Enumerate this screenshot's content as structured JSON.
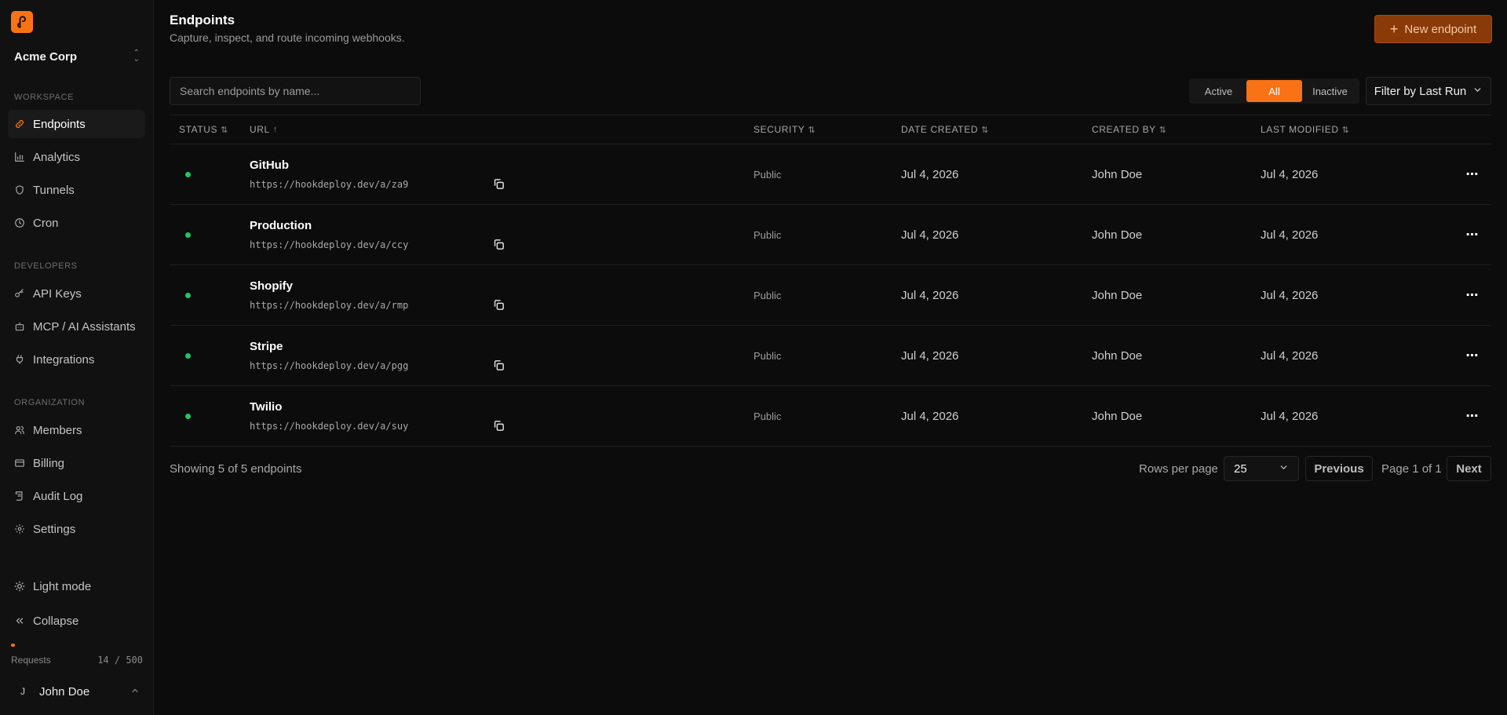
{
  "brand": {
    "accent": "#f97316",
    "status_active_color": "#22c55e",
    "logo_icon": "hook-logo-icon"
  },
  "org": {
    "name": "Acme Corp"
  },
  "sidebar": {
    "sections": [
      {
        "label": "WORKSPACE",
        "items": [
          {
            "label": "Endpoints",
            "icon": "link-icon",
            "active": true
          },
          {
            "label": "Analytics",
            "icon": "bar-chart-icon"
          },
          {
            "label": "Tunnels",
            "icon": "shield-icon"
          },
          {
            "label": "Cron",
            "icon": "clock-icon"
          }
        ]
      },
      {
        "label": "DEVELOPERS",
        "items": [
          {
            "label": "API Keys",
            "icon": "key-icon"
          },
          {
            "label": "MCP / AI Assistants",
            "icon": "bot-icon"
          },
          {
            "label": "Integrations",
            "icon": "plug-icon"
          }
        ]
      },
      {
        "label": "ORGANIZATION",
        "items": [
          {
            "label": "Members",
            "icon": "users-icon"
          },
          {
            "label": "Billing",
            "icon": "credit-card-icon"
          },
          {
            "label": "Audit Log",
            "icon": "scroll-icon"
          },
          {
            "label": "Settings",
            "icon": "gear-icon"
          }
        ]
      }
    ],
    "light_mode": "Light mode",
    "collapse": "Collapse",
    "usage": {
      "label": "Requests",
      "value": "14 / 500",
      "used": 14,
      "limit": 500
    },
    "user": {
      "initial": "J",
      "name": "John Doe"
    }
  },
  "header": {
    "title": "Endpoints",
    "subtitle": "Capture, inspect, and route incoming webhooks.",
    "new_button": "New endpoint"
  },
  "toolbar": {
    "search_placeholder": "Search endpoints by name...",
    "segments": [
      "Active",
      "All",
      "Inactive"
    ],
    "selected_segment": "All",
    "filter_label": "Filter by Last Run"
  },
  "table": {
    "columns": [
      "STATUS",
      "URL",
      "SECURITY",
      "DATE CREATED",
      "CREATED BY",
      "LAST MODIFIED"
    ],
    "rows": [
      {
        "name": "GitHub",
        "url": "https://hookdeploy.dev/a/za9",
        "security": "Public",
        "date_created": "Jul 4, 2026",
        "created_by": "John Doe",
        "last_modified": "Jul 4, 2026"
      },
      {
        "name": "Production",
        "url": "https://hookdeploy.dev/a/ccy",
        "security": "Public",
        "date_created": "Jul 4, 2026",
        "created_by": "John Doe",
        "last_modified": "Jul 4, 2026"
      },
      {
        "name": "Shopify",
        "url": "https://hookdeploy.dev/a/rmp",
        "security": "Public",
        "date_created": "Jul 4, 2026",
        "created_by": "John Doe",
        "last_modified": "Jul 4, 2026"
      },
      {
        "name": "Stripe",
        "url": "https://hookdeploy.dev/a/pgg",
        "security": "Public",
        "date_created": "Jul 4, 2026",
        "created_by": "John Doe",
        "last_modified": "Jul 4, 2026"
      },
      {
        "name": "Twilio",
        "url": "https://hookdeploy.dev/a/suy",
        "security": "Public",
        "date_created": "Jul 4, 2026",
        "created_by": "John Doe",
        "last_modified": "Jul 4, 2026"
      }
    ]
  },
  "footer": {
    "showing": "Showing 5 of 5 endpoints",
    "rows_per_page_label": "Rows per page",
    "rows_per_page": "25",
    "previous": "Previous",
    "page_info": "Page 1 of 1",
    "next": "Next"
  }
}
